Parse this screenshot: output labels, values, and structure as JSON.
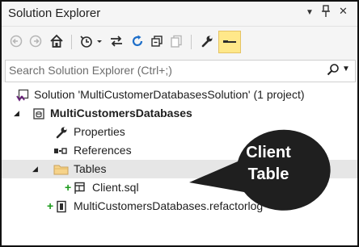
{
  "window": {
    "title": "Solution Explorer",
    "controls": {
      "dropdown_glyph": "▼",
      "pin_glyph": "ᵖ",
      "close_glyph": "✕"
    }
  },
  "toolbar": {
    "buttons": [
      "back-icon",
      "forward-icon",
      "home-icon",
      "history-icon",
      "sync-icon",
      "refresh-icon",
      "collapse-all-icon",
      "show-all-files-icon",
      "properties-wrench-icon",
      "preview-icon"
    ],
    "accent_color": "#ffe88a"
  },
  "search": {
    "placeholder": "Search Solution Explorer (Ctrl+;)"
  },
  "tree": {
    "solution": {
      "label": "Solution 'MultiCustomerDatabasesSolution' (1 project)"
    },
    "project": {
      "label": "MultiCustomersDatabases"
    },
    "properties": {
      "label": "Properties"
    },
    "references": {
      "label": "References"
    },
    "tables": {
      "label": "Tables"
    },
    "client_sql": {
      "label": "Client.sql",
      "status": "+"
    },
    "refactorlog": {
      "label": "MultiCustomersDatabases.refactorlog",
      "status": "+"
    }
  },
  "callout": {
    "line1": "Client",
    "line2": "Table",
    "color": "#1f1f1f"
  }
}
